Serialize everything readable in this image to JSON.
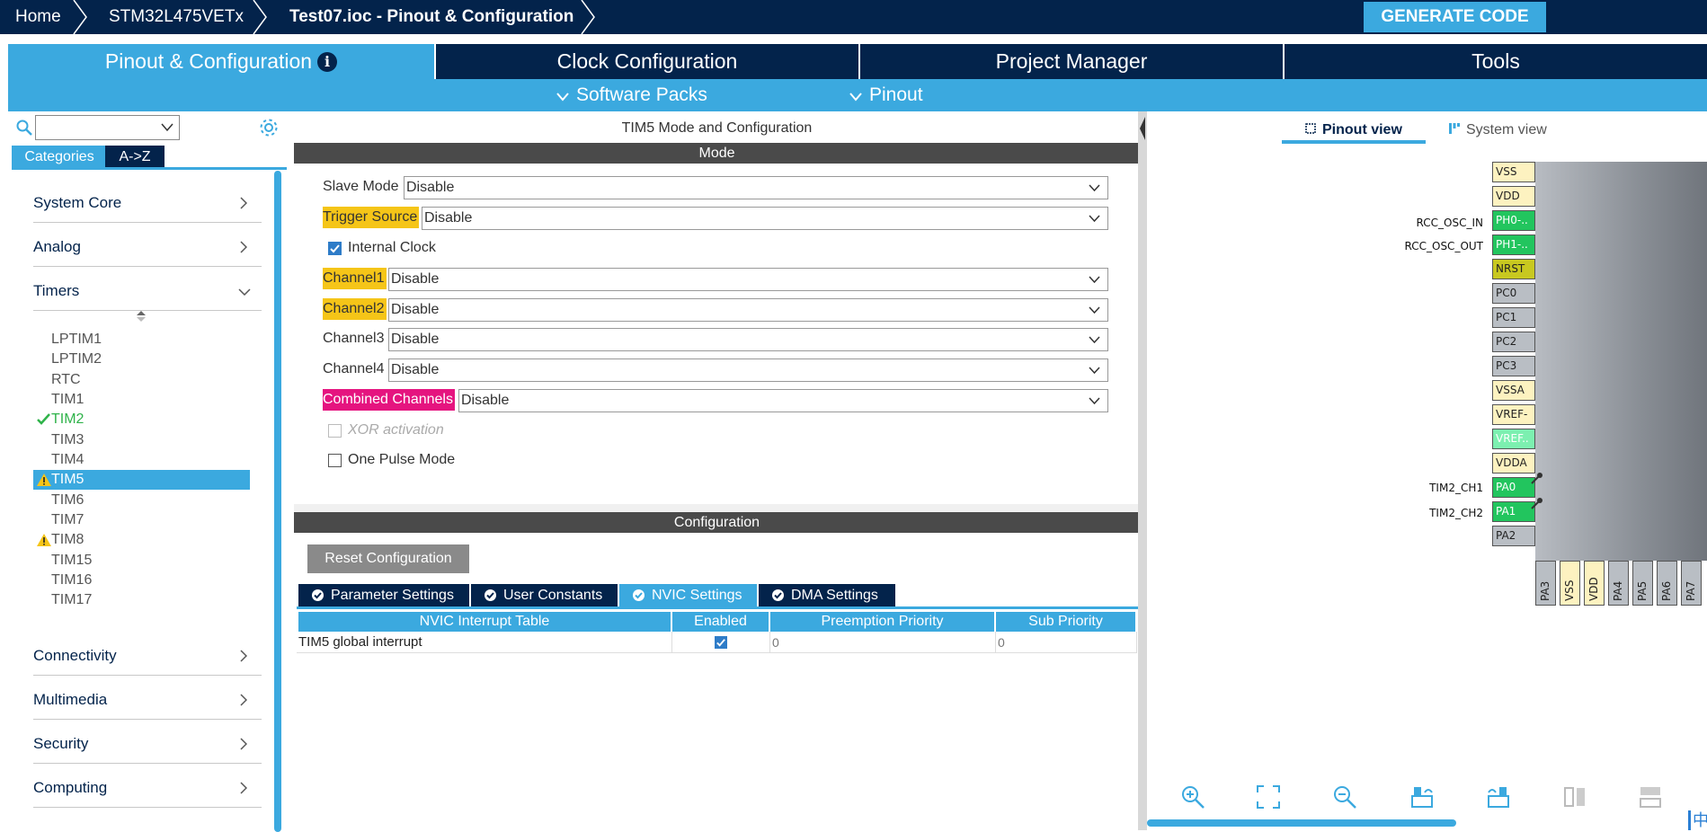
{
  "breadcrumb": {
    "home": "Home",
    "device": "STM32L475VETx",
    "file": "Test07.ioc - Pinout & Configuration"
  },
  "generate_label": "GENERATE CODE",
  "main_tabs": {
    "pinout": "Pinout & Configuration",
    "clock": "Clock Configuration",
    "project": "Project Manager",
    "tools": "Tools"
  },
  "subbar": {
    "software_packs": "Software Packs",
    "pinout": "Pinout"
  },
  "left": {
    "search_value": "",
    "categories_tab": "Categories",
    "az_tab": "A->Z",
    "cat_system_core": "System Core",
    "cat_analog": "Analog",
    "cat_timers": "Timers",
    "cat_connectivity": "Connectivity",
    "cat_multimedia": "Multimedia",
    "cat_security": "Security",
    "cat_computing": "Computing",
    "timers": [
      "LPTIM1",
      "LPTIM2",
      "RTC",
      "TIM1",
      "TIM2",
      "TIM3",
      "TIM4",
      "TIM5",
      "TIM6",
      "TIM7",
      "TIM8",
      "TIM15",
      "TIM16",
      "TIM17"
    ]
  },
  "mode": {
    "title": "TIM5 Mode and Configuration",
    "section": "Mode",
    "slave_mode_label": "Slave Mode",
    "slave_mode_value": "Disable",
    "trigger_label": "Trigger Source",
    "trigger_value": "Disable",
    "internal_clock_label": "Internal Clock",
    "ch1_label": "Channel1",
    "ch1_value": "Disable",
    "ch2_label": "Channel2",
    "ch2_value": "Disable",
    "ch3_label": "Channel3",
    "ch3_value": "Disable",
    "ch4_label": "Channel4",
    "ch4_value": "Disable",
    "combined_label": "Combined Channels",
    "combined_value": "Disable",
    "xor_label": "XOR activation",
    "one_pulse_label": "One Pulse Mode"
  },
  "config": {
    "section": "Configuration",
    "reset_label": "Reset Configuration",
    "tab_param": "Parameter Settings",
    "tab_user": "User Constants",
    "tab_nvic": "NVIC Settings",
    "tab_dma": "DMA Settings",
    "col_table": "NVIC Interrupt Table",
    "col_enabled": "Enabled",
    "col_preempt": "Preemption Priority",
    "col_sub": "Sub Priority",
    "row_name": "TIM5 global interrupt",
    "row_preempt": "0",
    "row_sub": "0"
  },
  "right": {
    "pinout_view": "Pinout view",
    "system_view": "System view",
    "pins_left": [
      "VSS",
      "VDD",
      "PH0-..",
      "PH1-..",
      "NRST",
      "PC0",
      "PC1",
      "PC2",
      "PC3",
      "VSSA",
      "VREF-",
      "VREF..",
      "VDDA",
      "PA0",
      "PA1",
      "PA2"
    ],
    "pin_labels": {
      "ph0": "RCC_OSC_IN",
      "ph1": "RCC_OSC_OUT",
      "pa0": "TIM2_CH1",
      "pa1": "TIM2_CH2"
    },
    "pins_bottom": [
      "PA3",
      "VSS",
      "VDD",
      "PA4",
      "PA5",
      "PA6",
      "PA7"
    ],
    "ime": "中"
  },
  "colors": {
    "navy": "#03234b",
    "accent": "#3ba9df",
    "warn_yellow": "#f5c518",
    "warn_pink": "#e5147f",
    "pin_green": "#22c55e"
  }
}
